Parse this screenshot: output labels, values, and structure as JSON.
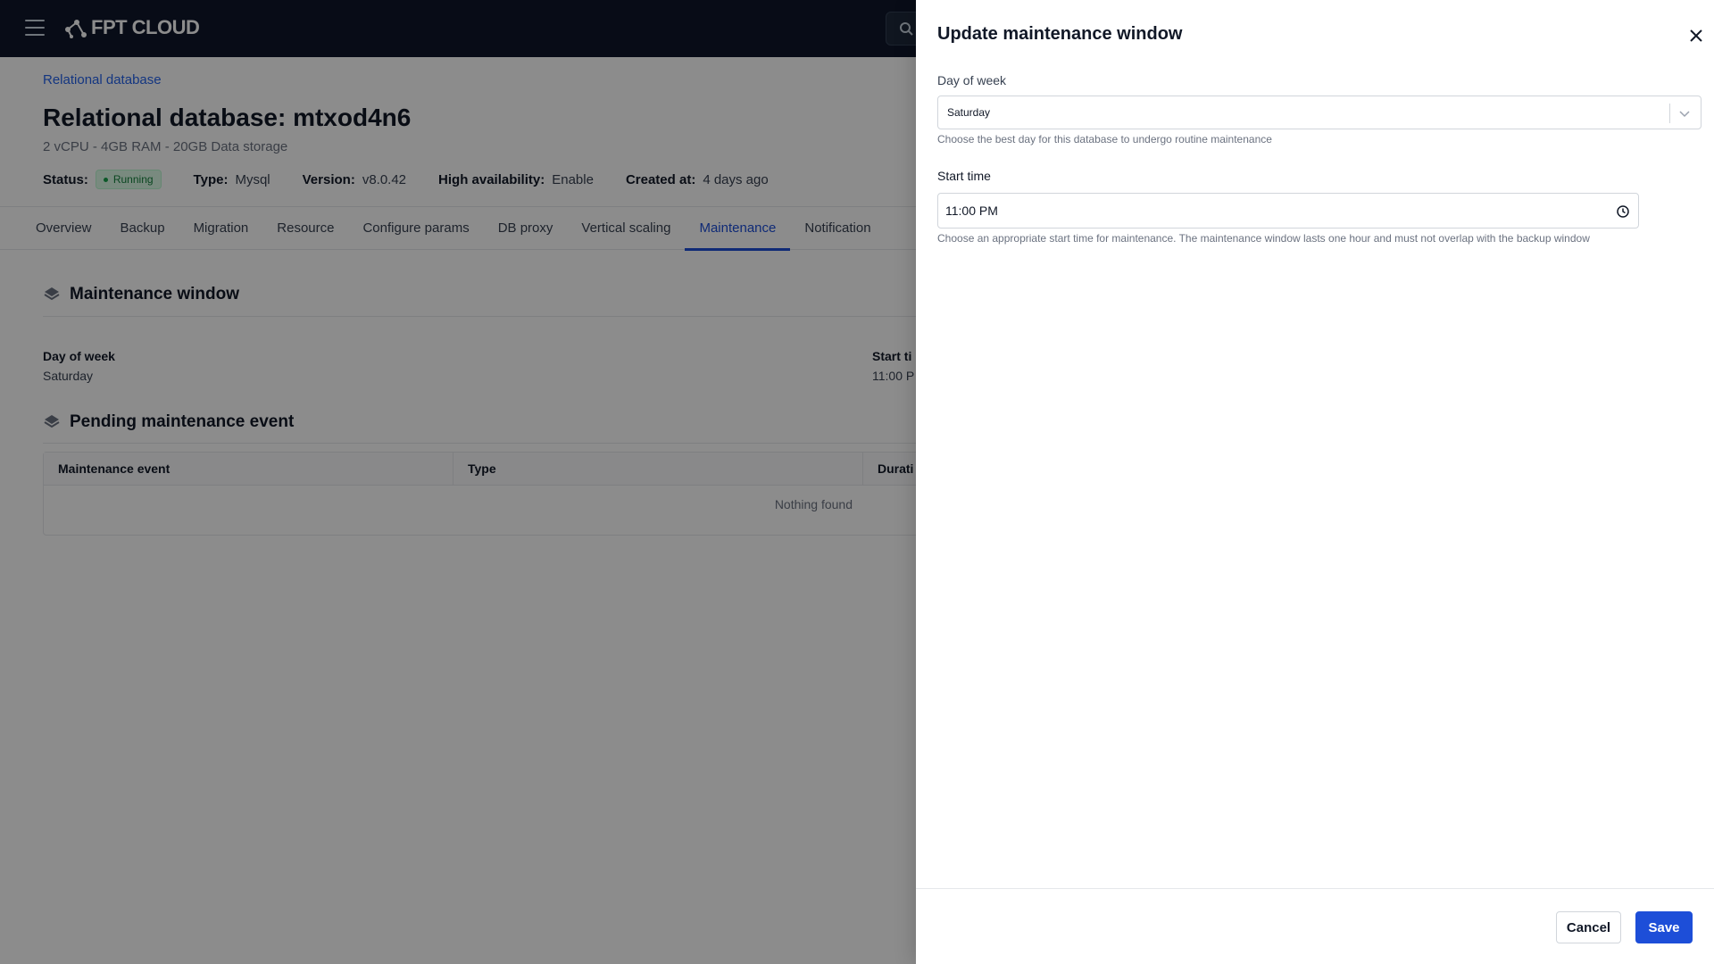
{
  "topbar": {
    "logo_text": "FPT CLOUD"
  },
  "page": {
    "breadcrumb": "Relational database",
    "title": "Relational database: mtxod4n6",
    "subtitle": "2 vCPU - 4GB RAM - 20GB Data storage",
    "meta": {
      "status_label": "Status:",
      "status_value": "Running",
      "type_label": "Type:",
      "type_value": "Mysql",
      "version_label": "Version:",
      "version_value": "v8.0.42",
      "ha_label": "High availability:",
      "ha_value": "Enable",
      "created_label": "Created at:",
      "created_value": "4 days ago"
    },
    "tabs": [
      "Overview",
      "Backup",
      "Migration",
      "Resource",
      "Configure params",
      "DB proxy",
      "Vertical scaling",
      "Maintenance",
      "Notification"
    ],
    "active_tab": "Maintenance",
    "maintenance_window": {
      "title": "Maintenance window",
      "day_label": "Day of week",
      "day_value": "Saturday",
      "start_label": "Start ti",
      "start_value": "11:00 P"
    },
    "pending": {
      "title": "Pending maintenance event",
      "columns": [
        "Maintenance event",
        "Type",
        "Durati"
      ],
      "empty_text": "Nothing found"
    }
  },
  "drawer": {
    "title": "Update maintenance window",
    "day_label": "Day of week",
    "day_value": "Saturday",
    "day_hint": "Choose the best day for this database to undergo routine maintenance",
    "start_label": "Start time",
    "start_value": "11:00 PM",
    "start_hint": "Choose an appropriate start time for maintenance. The maintenance window lasts one hour and must not overlap with the backup window",
    "cancel_label": "Cancel",
    "save_label": "Save"
  },
  "colors": {
    "accent": "#1d4ed8",
    "status_green": "#15803d",
    "nav_bg": "#0f172a"
  }
}
